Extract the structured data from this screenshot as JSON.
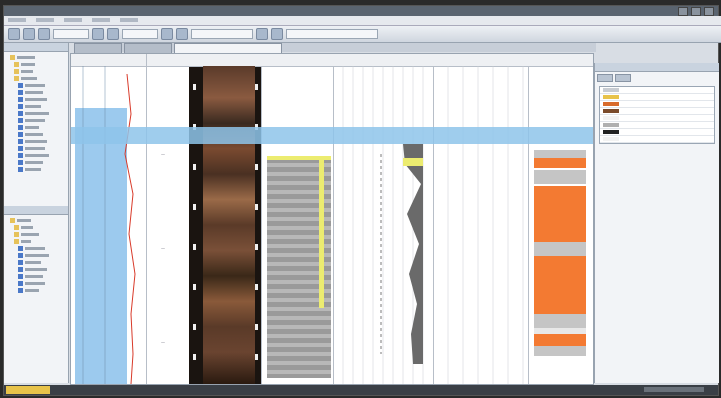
{
  "titlebar": {
    "title": ""
  },
  "menubar": {
    "items": []
  },
  "tabs": [],
  "left_panel": {
    "section1_title": "",
    "section2_title": ""
  },
  "right_panel": {
    "title": ""
  },
  "status": {
    "text": ""
  },
  "colors": {
    "core_blue": "#9ccaee",
    "lithology_orange": "#f37a32",
    "lithology_gray": "#c5c5c5",
    "highlight_yellow": "#ecec70",
    "status_yellow": "#e8c34a"
  },
  "tree_icons": [
    "folder-icon",
    "well-icon",
    "log-icon",
    "core-icon",
    "image-icon",
    "layer-icon"
  ]
}
